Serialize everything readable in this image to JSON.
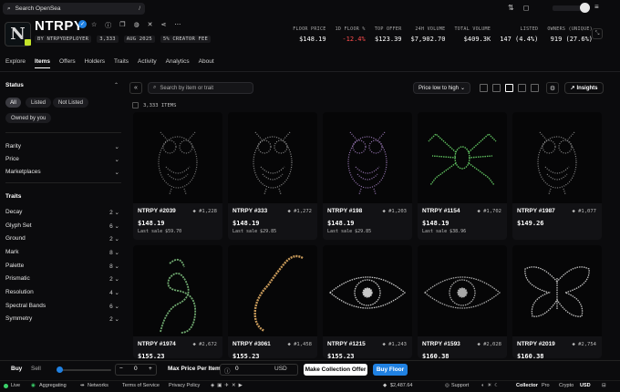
{
  "search": {
    "placeholder": "Search OpenSea",
    "shortcut": "/"
  },
  "collection": {
    "name": "NTRPY",
    "creator": "BY NTRPYDEPLOYER",
    "items": "3,333",
    "date": "AUG 2025",
    "fee": "5% CREATOR FEE"
  },
  "stats": [
    {
      "label": "FLOOR PRICE",
      "value": "$148.19",
      "neg": false
    },
    {
      "label": "1D FLOOR %",
      "value": "-12.4%",
      "neg": true
    },
    {
      "label": "TOP OFFER",
      "value": "$123.39",
      "neg": false
    },
    {
      "label": "24H VOLUME",
      "value": "$7,902.70",
      "neg": false
    },
    {
      "label": "TOTAL VOLUME",
      "value": "$409.3K",
      "neg": false
    },
    {
      "label": "LISTED",
      "value": "147 (4.4%)",
      "neg": false
    },
    {
      "label": "OWNERS (UNIQUE)",
      "value": "919 (27.6%)",
      "neg": false
    }
  ],
  "tabs": [
    "Explore",
    "Items",
    "Offers",
    "Holders",
    "Traits",
    "Activity",
    "Analytics",
    "About"
  ],
  "sidebar": {
    "status_title": "Status",
    "status_pills": [
      "All",
      "Listed",
      "Not Listed",
      "Owned by you"
    ],
    "filters": [
      "Rarity",
      "Price",
      "Marketplaces"
    ],
    "traits_title": "Traits",
    "traits": [
      {
        "name": "Decay",
        "count": "2"
      },
      {
        "name": "Glyph Set",
        "count": "6"
      },
      {
        "name": "Ground",
        "count": "2"
      },
      {
        "name": "Mark",
        "count": "8"
      },
      {
        "name": "Palette",
        "count": "8"
      },
      {
        "name": "Prismatic",
        "count": "2"
      },
      {
        "name": "Resolution",
        "count": "4"
      },
      {
        "name": "Spectral Bands",
        "count": "6"
      },
      {
        "name": "Symmetry",
        "count": "2"
      }
    ]
  },
  "toolbar": {
    "search_placeholder": "Search by item or trait",
    "sort": "Price low to high",
    "insights": "Insights"
  },
  "items_count": "3,333 ITEMS",
  "cards": [
    {
      "name": "NTRPY #2039",
      "rank": "#1,228",
      "price": "$148.19",
      "last": "Last sale $59.70",
      "art": "owl",
      "color": "#8a8a8a"
    },
    {
      "name": "NTRPY #333",
      "rank": "#1,272",
      "price": "$148.19",
      "last": "Last sale $29.85",
      "art": "owl",
      "color": "#a0a0a0"
    },
    {
      "name": "NTRPY #198",
      "rank": "#1,203",
      "price": "$148.19",
      "last": "Last sale $29.85",
      "art": "owl",
      "color": "#b08ad0"
    },
    {
      "name": "NTRPY #1154",
      "rank": "#1,702",
      "price": "$148.19",
      "last": "Last sale $38.96",
      "art": "spider",
      "color": "#5fbf5f"
    },
    {
      "name": "NTRPY #1987",
      "rank": "#1,077",
      "price": "$149.26",
      "last": "",
      "art": "owl",
      "color": "#9a9a9a"
    },
    {
      "name": "NTRPY #1974",
      "rank": "#2,672",
      "price": "$155.23",
      "last": "",
      "art": "knot",
      "color": "#6fa86f"
    },
    {
      "name": "NTRPY #3061",
      "rank": "#1,458",
      "price": "$155.23",
      "last": "",
      "art": "snake",
      "color": "#c89a5a"
    },
    {
      "name": "NTRPY #1215",
      "rank": "#1,243",
      "price": "$155.23",
      "last": "",
      "art": "eye",
      "color": "#c8c8c8"
    },
    {
      "name": "NTRPY #1593",
      "rank": "#2,028",
      "price": "$160.38",
      "last": "",
      "art": "eye",
      "color": "#a8a8a8"
    },
    {
      "name": "NTRPY #2019",
      "rank": "#2,754",
      "price": "$160.38",
      "last": "",
      "art": "moth",
      "color": "#c0c0c0"
    }
  ],
  "bottom": {
    "buy": "Buy",
    "sell": "Sell",
    "minus": "−",
    "qty": "0",
    "plus": "+",
    "max_label": "Max Price Per Item",
    "max_value": "0",
    "currency": "USD",
    "make_offer": "Make Collection Offer",
    "buy_floor": "Buy Floor"
  },
  "status": {
    "live": "Live",
    "aggregating": "Aggregating",
    "networks": "Networks",
    "terms": "Terms of Service",
    "privacy": "Privacy Policy",
    "eth_price": "$2,487.64",
    "support": "Support",
    "collector": "Collector",
    "pro": "Pro",
    "crypto": "Crypto",
    "usd": "USD"
  }
}
